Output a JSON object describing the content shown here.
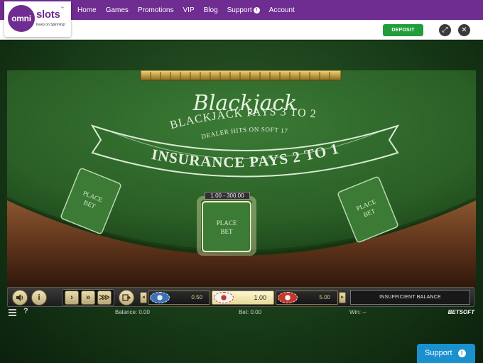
{
  "brand": {
    "logo_mark": "omni",
    "logo_word": "slots",
    "logo_tm": "™",
    "tagline": "Keep on Spinning!"
  },
  "nav": {
    "links": [
      "Home",
      "Games",
      "Promotions",
      "VIP",
      "Blog",
      "Support",
      "Account"
    ],
    "support_badge": "!"
  },
  "subbar": {
    "deposit_label": "DEPOSIT",
    "fullscreen_icon": "⤢",
    "close_icon": "✕"
  },
  "table": {
    "title": "Blackjack",
    "line1": "BLACKJACK PAYS 3 TO 2",
    "line2": "DEALER HITS ON SOFT 17",
    "line3": "INSURANCE PAYS 2 TO 1",
    "spot_label_line1": "PLACE",
    "spot_label_line2": "BET",
    "bet_range": "1.00 - 300.00",
    "felt_color": "#2f6b2a",
    "rail_color": "#5a3119"
  },
  "controls": {
    "sound_icon": "speaker-icon",
    "info_icon": "i",
    "speed_1": "›",
    "speed_2": "»",
    "speed_3": "⋙",
    "clear_icon": "clear-bets-icon",
    "chip_prev": "◂",
    "chip_next": "▸",
    "chips": [
      {
        "value": "0.50",
        "color": "#3f6fb5",
        "active": false
      },
      {
        "value": "1.00",
        "color": "#e8e8e8",
        "active": true
      },
      {
        "value": "5.00",
        "color": "#c0392b",
        "active": false
      }
    ],
    "message": "INSUFFICIENT BALANCE"
  },
  "status": {
    "help": "?",
    "balance": "Balance: 0.00",
    "bet": "Bet: 0.00",
    "win": "Win: --",
    "provider": "BETSOFT"
  },
  "support_widget": {
    "label": "Support",
    "badge": "!"
  }
}
